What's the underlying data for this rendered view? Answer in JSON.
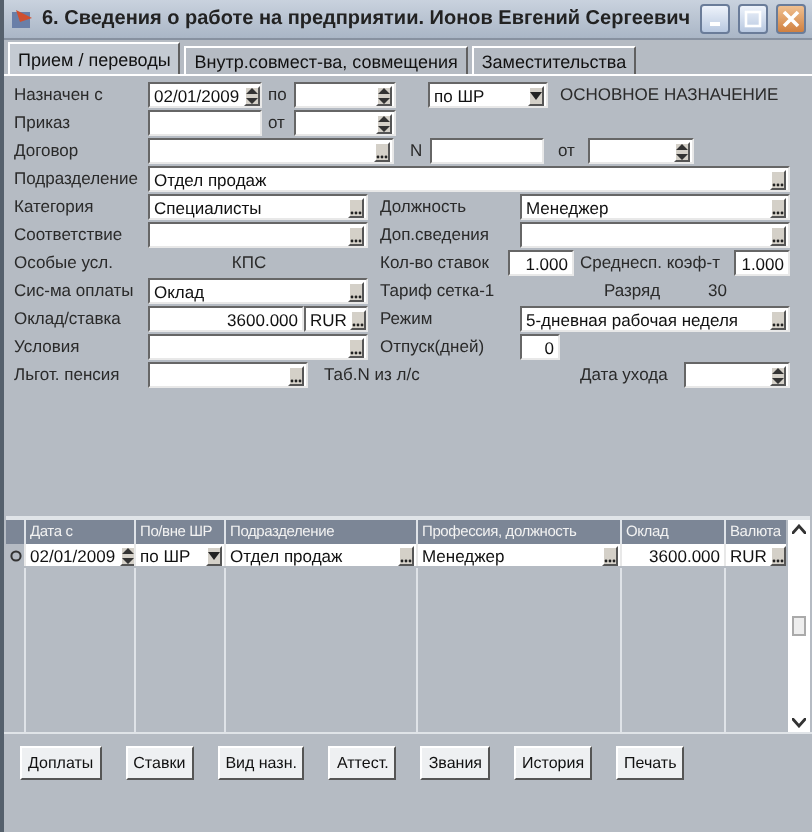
{
  "window": {
    "title": "6. Сведения о работе на предприятии. Ионов Евгений Сергеевич"
  },
  "tabs": [
    {
      "label": "Прием / переводы",
      "selected": true
    },
    {
      "label": "Внутр.совмест-ва, совмещения",
      "selected": false
    },
    {
      "label": "Заместительства",
      "selected": false
    }
  ],
  "form": [
    [
      {
        "kind": "label",
        "text": "Назначен с"
      },
      {
        "kind": "date",
        "value": "02/01/2009"
      },
      {
        "kind": "label",
        "text": "по"
      },
      {
        "kind": "date"
      },
      {
        "kind": "combo",
        "value": "по ШР"
      },
      {
        "kind": "label",
        "text": "ОСНОВНОЕ НАЗНАЧЕНИЕ"
      }
    ],
    [
      {
        "kind": "label",
        "text": "Приказ"
      },
      {
        "kind": "input"
      },
      {
        "kind": "label",
        "text": "от"
      },
      {
        "kind": "date"
      }
    ],
    [
      {
        "kind": "label",
        "text": "Договор"
      },
      {
        "kind": "lookup"
      },
      {
        "kind": "label",
        "text": "N"
      },
      {
        "kind": "input"
      },
      {
        "kind": "label",
        "text": "от"
      },
      {
        "kind": "date"
      }
    ],
    [
      {
        "kind": "label",
        "text": "Подразделение"
      },
      {
        "kind": "lookup",
        "value": "Отдел продаж"
      }
    ],
    [
      {
        "kind": "label",
        "text": "Категория"
      },
      {
        "kind": "lookup",
        "value": "Специалисты"
      },
      {
        "kind": "label",
        "text": "Должность"
      },
      {
        "kind": "lookup",
        "value": "Менеджер"
      }
    ],
    [
      {
        "kind": "label",
        "text": "Соответствие"
      },
      {
        "kind": "lookup"
      },
      {
        "kind": "label",
        "text": "Доп.сведения"
      },
      {
        "kind": "lookup"
      }
    ],
    [
      {
        "kind": "label",
        "text": "Особые усл."
      },
      {
        "kind": "note",
        "text": "КПС"
      },
      {
        "kind": "label",
        "text": "Кол-во ставок"
      },
      {
        "kind": "number",
        "value": "1.000"
      },
      {
        "kind": "label",
        "text": "Среднесп. коэф-т"
      },
      {
        "kind": "number",
        "value": "1.000"
      }
    ],
    [
      {
        "kind": "label",
        "text": "Сис-ма оплаты"
      },
      {
        "kind": "lookup",
        "value": "Оклад"
      },
      {
        "kind": "label",
        "text": "Тариф  сетка-1"
      },
      {
        "kind": "label",
        "text": "Разряд"
      },
      {
        "kind": "label",
        "text": "30"
      }
    ],
    [
      {
        "kind": "label",
        "text": "Оклад/ставка"
      },
      {
        "kind": "number",
        "value": "3600.000"
      },
      {
        "kind": "lookup",
        "value": "RUR"
      },
      {
        "kind": "label",
        "text": "Режим"
      },
      {
        "kind": "lookup",
        "value": "5-дневная рабочая неделя"
      }
    ],
    [
      {
        "kind": "label",
        "text": "Условия"
      },
      {
        "kind": "lookup"
      },
      {
        "kind": "label",
        "text": "Отпуск(дней)"
      },
      {
        "kind": "number",
        "value": "0"
      }
    ],
    [
      {
        "kind": "label",
        "text": "Льгот. пенсия"
      },
      {
        "kind": "lookup"
      },
      {
        "kind": "label",
        "text": "Таб.N из л/с"
      },
      {
        "kind": "label",
        "text": "Дата ухода"
      },
      {
        "kind": "date"
      }
    ]
  ],
  "table": {
    "columns": [
      "Дата с",
      "По/вне ШР",
      "Подразделение",
      "Профессия, должность",
      "Оклад",
      "Валюта"
    ],
    "rows": [
      {
        "selected": true,
        "cells": [
          {
            "kind": "date",
            "value": "02/01/2009"
          },
          {
            "kind": "combo",
            "value": "по ШР"
          },
          {
            "kind": "lookup",
            "value": "Отдел продаж"
          },
          {
            "kind": "lookup",
            "value": "Менеджер"
          },
          {
            "kind": "number",
            "value": "3600.000"
          },
          {
            "kind": "lookup",
            "value": "RUR"
          }
        ]
      }
    ]
  },
  "buttons": [
    "Доплаты",
    "Ставки",
    "Вид назн.",
    "Аттест.",
    "Звания",
    "История",
    "Печать"
  ]
}
